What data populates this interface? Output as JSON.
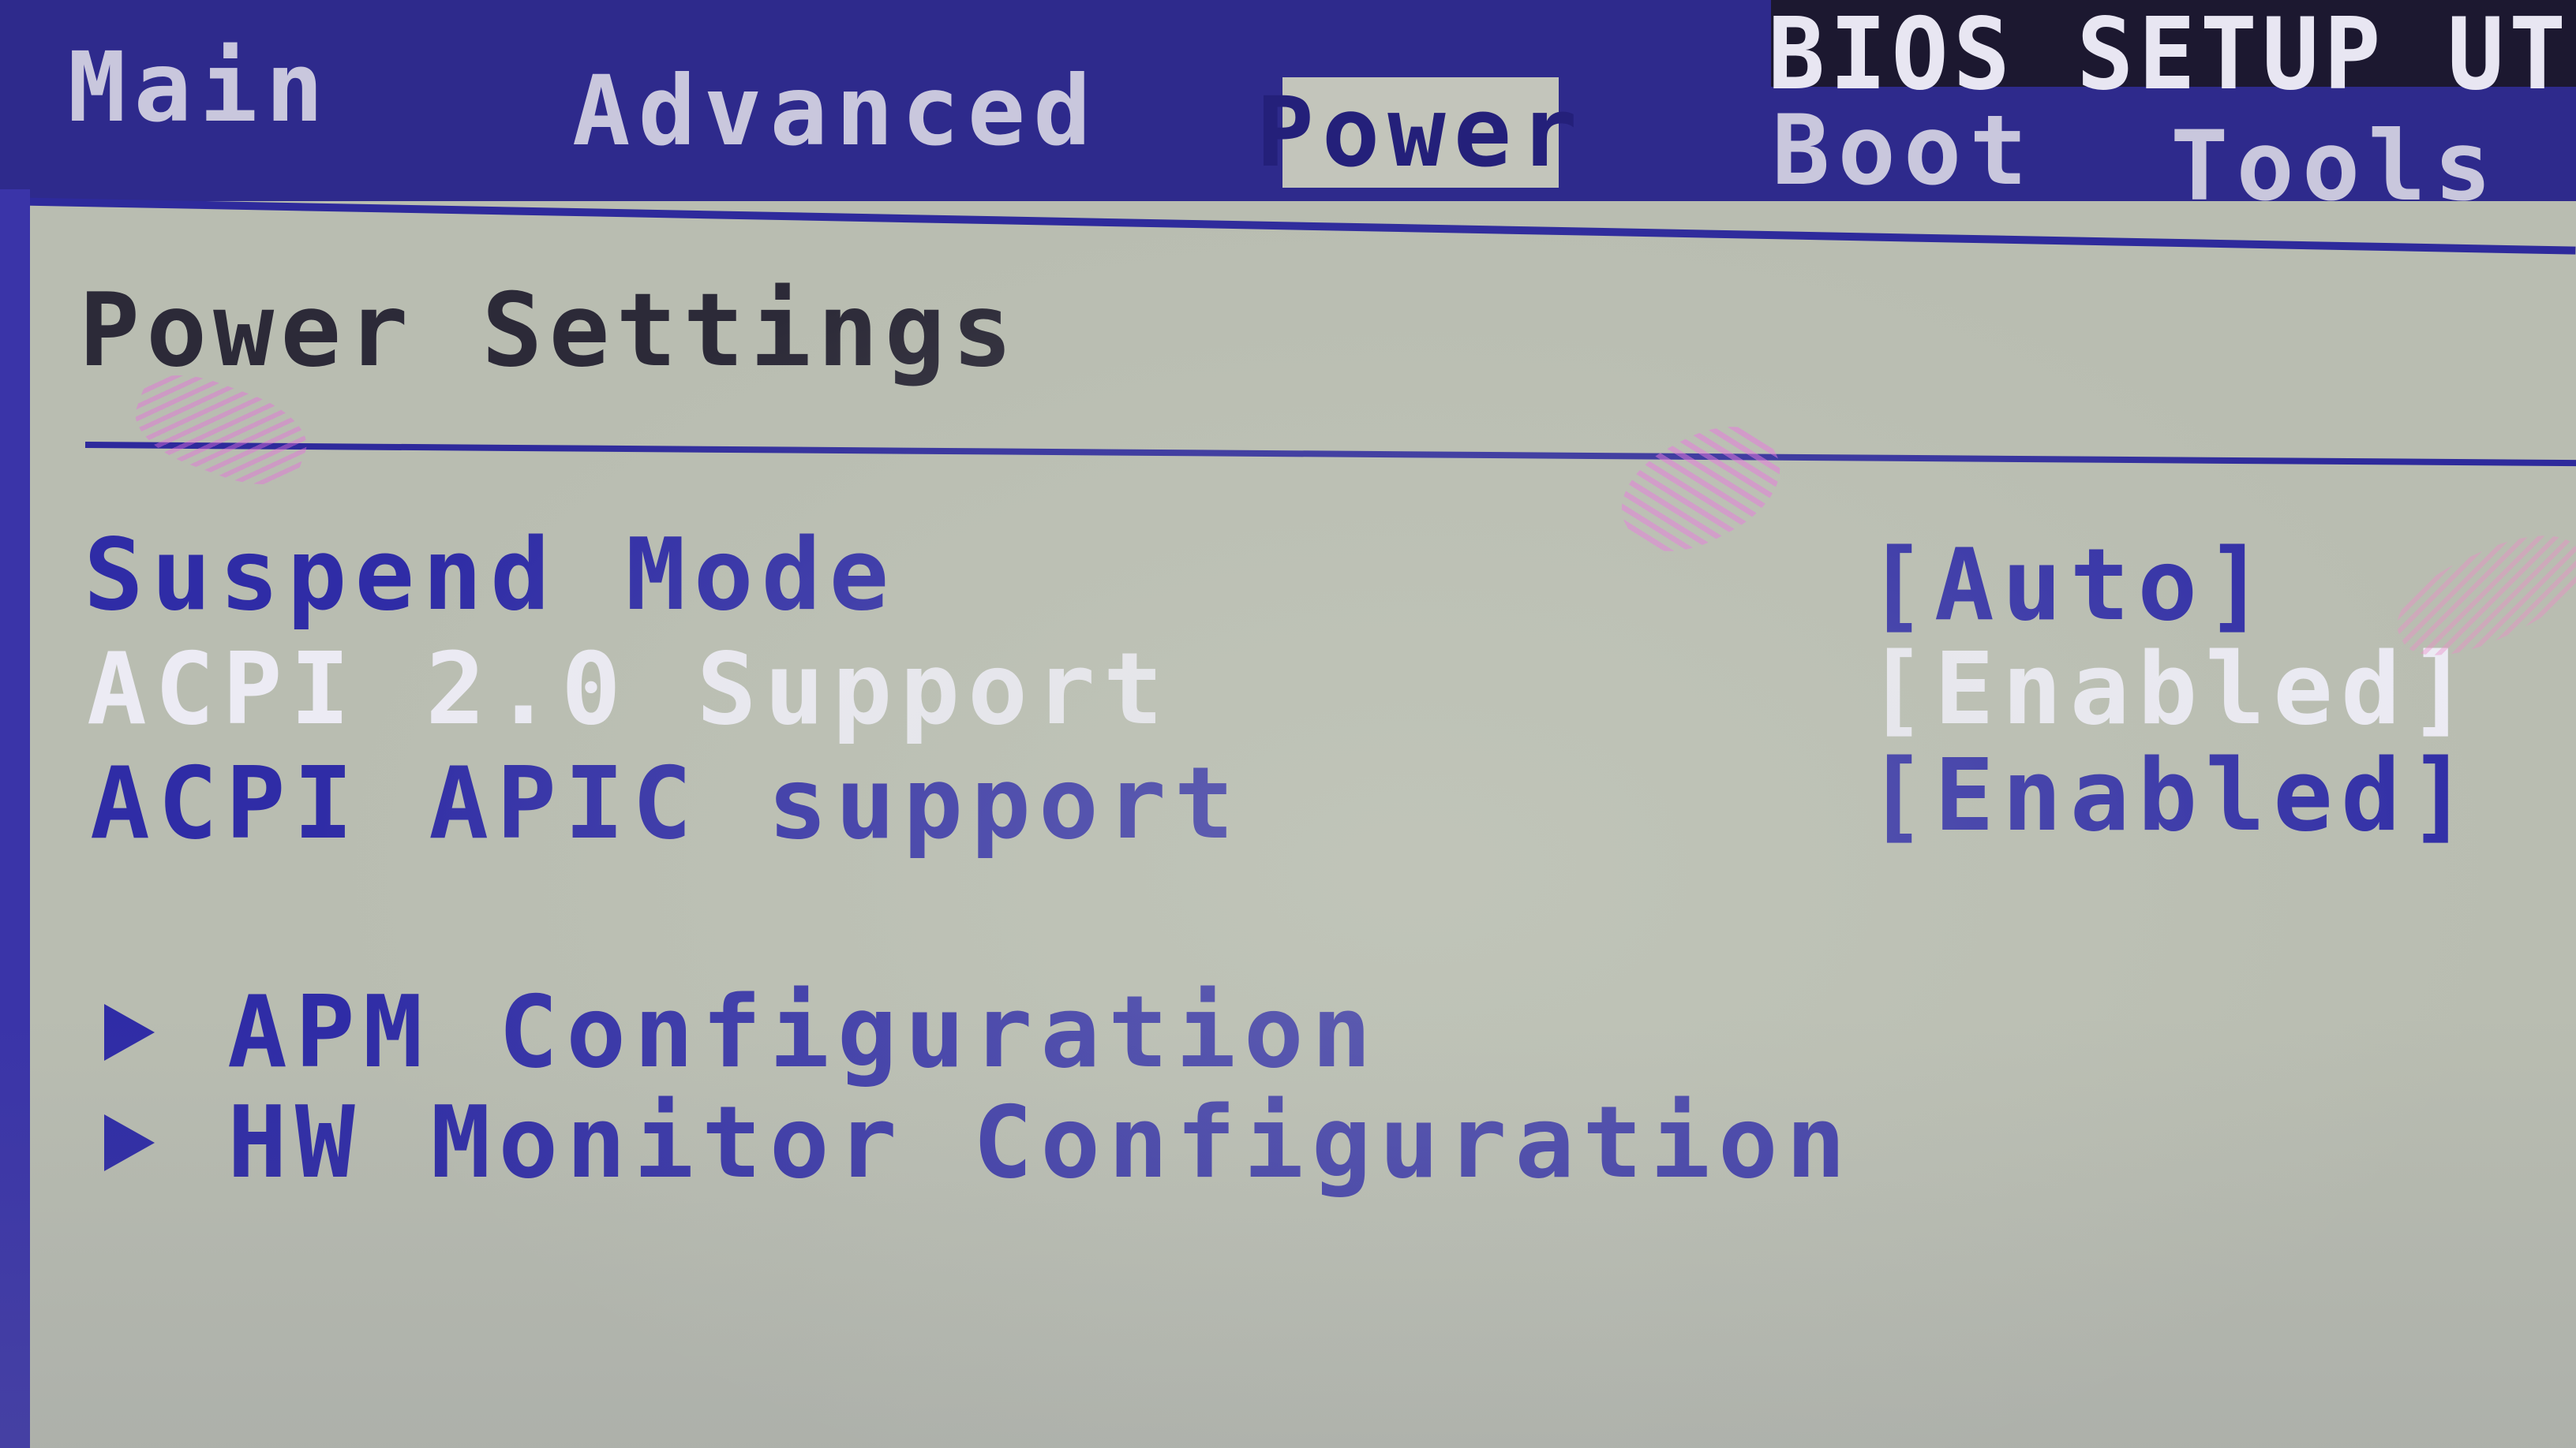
{
  "header": {
    "utility_title": "BIOS SETUP UTILIT",
    "tabs": [
      {
        "label": "Main"
      },
      {
        "label": "Advanced"
      },
      {
        "label": "Power"
      },
      {
        "label": "Boot"
      },
      {
        "label": "Tools"
      }
    ],
    "active_tab": "Power"
  },
  "main": {
    "title": "Power Settings",
    "settings": [
      {
        "label": "Suspend Mode",
        "value": "[Auto]"
      },
      {
        "label": "ACPI 2.0 Support",
        "value": "[Enabled]"
      },
      {
        "label": "ACPI APIC support",
        "value": "[Enabled]"
      }
    ],
    "submenus": [
      {
        "label": "APM Configuration",
        "icon": "arrow-right-icon"
      },
      {
        "label": "HW Monitor Configuration",
        "icon": "arrow-right-icon"
      }
    ]
  },
  "colors": {
    "menubar": "#2e2a8c",
    "background": "#b9bdb1",
    "highlight_text": "#ecebf4",
    "item_text": "#2f2ca6"
  }
}
